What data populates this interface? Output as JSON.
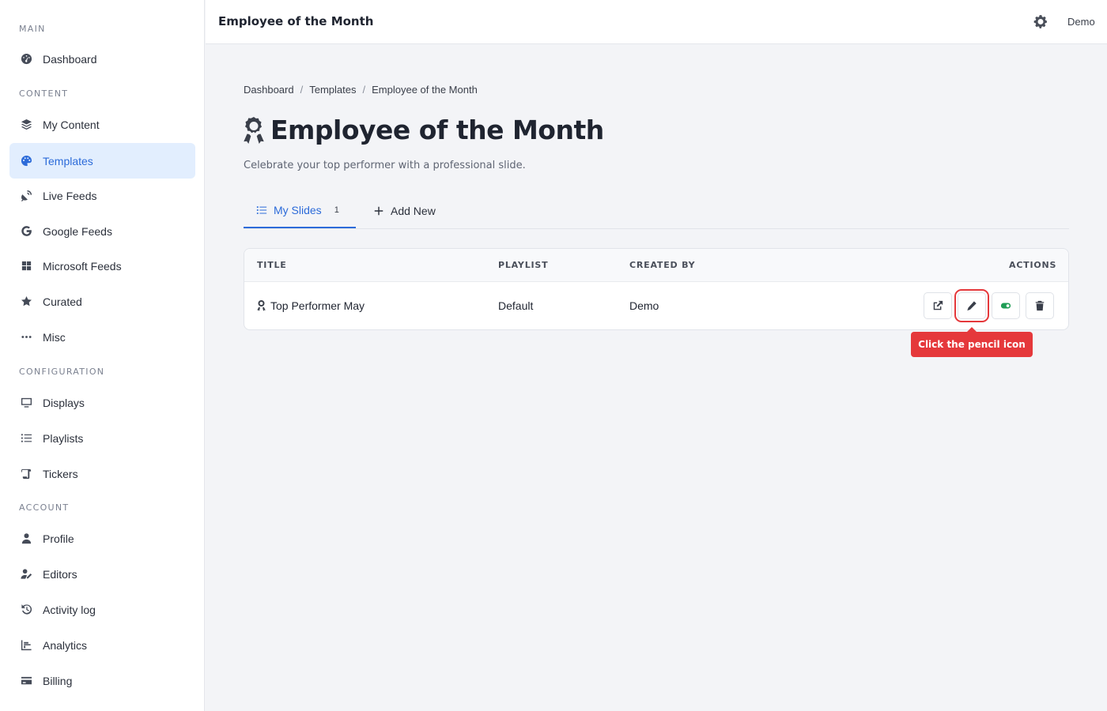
{
  "sidebar": {
    "sections": {
      "main": "MAIN",
      "content": "CONTENT",
      "configuration": "CONFIGURATION",
      "account": "ACCOUNT"
    },
    "items": {
      "dashboard": {
        "label": "Dashboard",
        "icon": "gauge-icon"
      },
      "my_content": {
        "label": "My Content",
        "icon": "layers-icon"
      },
      "templates": {
        "label": "Templates",
        "icon": "palette-icon"
      },
      "live_feeds": {
        "label": "Live Feeds",
        "icon": "satellite-dish-icon"
      },
      "google_feeds": {
        "label": "Google Feeds",
        "icon": "google-icon"
      },
      "microsoft_feeds": {
        "label": "Microsoft Feeds",
        "icon": "windows-icon"
      },
      "curated": {
        "label": "Curated",
        "icon": "star-icon"
      },
      "misc": {
        "label": "Misc",
        "icon": "ellipsis-icon"
      },
      "displays": {
        "label": "Displays",
        "icon": "monitor-icon"
      },
      "playlists": {
        "label": "Playlists",
        "icon": "list-icon"
      },
      "tickers": {
        "label": "Tickers",
        "icon": "scroll-icon"
      },
      "profile": {
        "label": "Profile",
        "icon": "user-icon"
      },
      "editors": {
        "label": "Editors",
        "icon": "user-pen-icon"
      },
      "activity_log": {
        "label": "Activity log",
        "icon": "history-icon"
      },
      "analytics": {
        "label": "Analytics",
        "icon": "chart-icon"
      },
      "billing": {
        "label": "Billing",
        "icon": "credit-card-icon"
      }
    }
  },
  "header": {
    "title": "Employee of the Month",
    "user": "Demo"
  },
  "breadcrumb": [
    "Dashboard",
    "Templates",
    "Employee of the Month"
  ],
  "breadcrumb_sep": "/",
  "page": {
    "title": "Employee of the Month",
    "subtitle": "Celebrate your top performer with a professional slide."
  },
  "tabs": {
    "my_slides": {
      "label": "My Slides",
      "count": "1"
    },
    "add_new": {
      "label": "Add New"
    }
  },
  "table": {
    "headers": {
      "title": "TITLE",
      "playlist": "PLAYLIST",
      "created_by": "CREATED BY",
      "actions": "ACTIONS"
    },
    "rows": [
      {
        "title": "Top Performer May",
        "playlist": "Default",
        "created_by": "Demo"
      }
    ]
  },
  "tooltip": "Click the pencil icon",
  "colors": {
    "accent": "#2c6bd9",
    "highlight": "#e5383b",
    "toggle_on": "#1f9d55"
  }
}
